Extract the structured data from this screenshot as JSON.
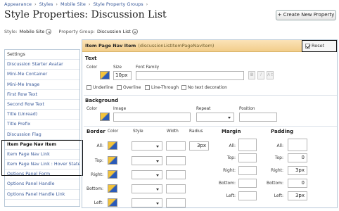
{
  "breadcrumb": [
    "Appearance",
    "Styles",
    "Mobile Site",
    "Style Property Groups"
  ],
  "breadcrumb_sep": "›",
  "page_title": "Style Properties: Discussion List",
  "create_button": "+ Create New Property",
  "style_selector": {
    "label": "Style:",
    "value": "Mobile Site"
  },
  "group_selector": {
    "label": "Property Group:",
    "value": "Discussion List"
  },
  "sidebar": {
    "items": [
      "Settings",
      "Discussion Starter Avatar",
      "Mini-Me Container",
      "Mini-Me Image",
      "First Row Text",
      "Second Row Text",
      "Title (Unread)",
      "Title Prefix",
      "Discussion Flag",
      "Item Page Nav Item",
      "Item Page Nav Link",
      "Item Page Nav Link : Hover State",
      "Options Panel Form",
      "Options Panel Handle",
      "Options Panel Handle Link"
    ],
    "active_index": 9
  },
  "panel": {
    "header_title": "Item Page Nav Item",
    "header_sub": "(discussionListItemPageNavItem)",
    "reset_label": "Reset",
    "reset_checked": true,
    "text": {
      "heading": "Text",
      "color_label": "Color",
      "size_label": "Size",
      "font_family_label": "Font Family",
      "size_value": "10px",
      "font_family_value": "",
      "bold": "B",
      "italic": "I",
      "font_size_btn": "A↕",
      "options": [
        {
          "label": "Underline",
          "checked": false
        },
        {
          "label": "Overline",
          "checked": false
        },
        {
          "label": "Line-Through",
          "checked": false
        },
        {
          "label": "No text decoration",
          "checked": false
        }
      ]
    },
    "background": {
      "heading": "Background",
      "color_label": "Color",
      "image_label": "Image",
      "repeat_label": "Repeat",
      "position_label": "Position",
      "image_value": "",
      "repeat_value": "",
      "position_value": ""
    },
    "border": {
      "heading": "Border",
      "color_label": "Color",
      "style_label": "Style",
      "width_label": "Width",
      "radius_label": "Radius",
      "rows": [
        {
          "label": "All:",
          "width": "",
          "radius": "3px"
        },
        {
          "label": "Top:",
          "width": "",
          "radius": ""
        },
        {
          "label": "Right:",
          "width": "",
          "radius": ""
        },
        {
          "label": "Bottom:",
          "width": "",
          "radius": ""
        },
        {
          "label": "Left:",
          "width": "",
          "radius": ""
        }
      ]
    },
    "margin": {
      "heading": "Margin",
      "rows": [
        {
          "label": "All:",
          "value": ""
        },
        {
          "label": "Top:",
          "value": ""
        },
        {
          "label": "Right:",
          "value": ""
        },
        {
          "label": "Bottom:",
          "value": ""
        },
        {
          "label": "Left:",
          "value": ""
        }
      ]
    },
    "padding": {
      "heading": "Padding",
      "rows": [
        {
          "label": "All:",
          "value": ""
        },
        {
          "label": "Top:",
          "value": "0"
        },
        {
          "label": "Right:",
          "value": "3px"
        },
        {
          "label": "Bottom:",
          "value": "0"
        },
        {
          "label": "Left:",
          "value": "3px"
        }
      ]
    }
  },
  "colors": {
    "accent": "#3a5a9a",
    "header_gradient_top": "#fbe3b8",
    "header_gradient_bottom": "#f2cd8a",
    "swatch_yellow": "#f3c33a",
    "swatch_blue": "#2a5ab8"
  }
}
